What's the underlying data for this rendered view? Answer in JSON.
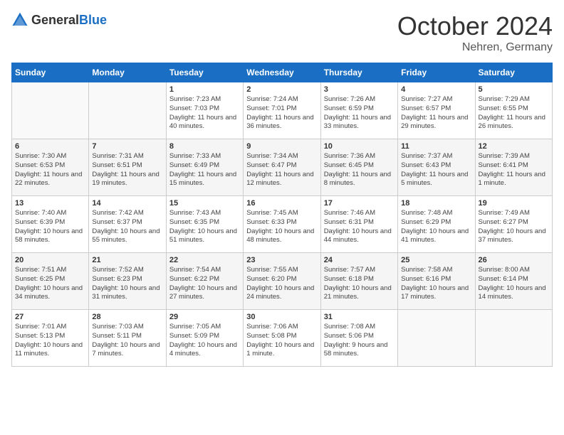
{
  "header": {
    "logo_general": "General",
    "logo_blue": "Blue",
    "month": "October 2024",
    "location": "Nehren, Germany"
  },
  "days_of_week": [
    "Sunday",
    "Monday",
    "Tuesday",
    "Wednesday",
    "Thursday",
    "Friday",
    "Saturday"
  ],
  "weeks": [
    [
      {
        "day": "",
        "info": ""
      },
      {
        "day": "",
        "info": ""
      },
      {
        "day": "1",
        "info": "Sunrise: 7:23 AM\nSunset: 7:03 PM\nDaylight: 11 hours and 40 minutes."
      },
      {
        "day": "2",
        "info": "Sunrise: 7:24 AM\nSunset: 7:01 PM\nDaylight: 11 hours and 36 minutes."
      },
      {
        "day": "3",
        "info": "Sunrise: 7:26 AM\nSunset: 6:59 PM\nDaylight: 11 hours and 33 minutes."
      },
      {
        "day": "4",
        "info": "Sunrise: 7:27 AM\nSunset: 6:57 PM\nDaylight: 11 hours and 29 minutes."
      },
      {
        "day": "5",
        "info": "Sunrise: 7:29 AM\nSunset: 6:55 PM\nDaylight: 11 hours and 26 minutes."
      }
    ],
    [
      {
        "day": "6",
        "info": "Sunrise: 7:30 AM\nSunset: 6:53 PM\nDaylight: 11 hours and 22 minutes."
      },
      {
        "day": "7",
        "info": "Sunrise: 7:31 AM\nSunset: 6:51 PM\nDaylight: 11 hours and 19 minutes."
      },
      {
        "day": "8",
        "info": "Sunrise: 7:33 AM\nSunset: 6:49 PM\nDaylight: 11 hours and 15 minutes."
      },
      {
        "day": "9",
        "info": "Sunrise: 7:34 AM\nSunset: 6:47 PM\nDaylight: 11 hours and 12 minutes."
      },
      {
        "day": "10",
        "info": "Sunrise: 7:36 AM\nSunset: 6:45 PM\nDaylight: 11 hours and 8 minutes."
      },
      {
        "day": "11",
        "info": "Sunrise: 7:37 AM\nSunset: 6:43 PM\nDaylight: 11 hours and 5 minutes."
      },
      {
        "day": "12",
        "info": "Sunrise: 7:39 AM\nSunset: 6:41 PM\nDaylight: 11 hours and 1 minute."
      }
    ],
    [
      {
        "day": "13",
        "info": "Sunrise: 7:40 AM\nSunset: 6:39 PM\nDaylight: 10 hours and 58 minutes."
      },
      {
        "day": "14",
        "info": "Sunrise: 7:42 AM\nSunset: 6:37 PM\nDaylight: 10 hours and 55 minutes."
      },
      {
        "day": "15",
        "info": "Sunrise: 7:43 AM\nSunset: 6:35 PM\nDaylight: 10 hours and 51 minutes."
      },
      {
        "day": "16",
        "info": "Sunrise: 7:45 AM\nSunset: 6:33 PM\nDaylight: 10 hours and 48 minutes."
      },
      {
        "day": "17",
        "info": "Sunrise: 7:46 AM\nSunset: 6:31 PM\nDaylight: 10 hours and 44 minutes."
      },
      {
        "day": "18",
        "info": "Sunrise: 7:48 AM\nSunset: 6:29 PM\nDaylight: 10 hours and 41 minutes."
      },
      {
        "day": "19",
        "info": "Sunrise: 7:49 AM\nSunset: 6:27 PM\nDaylight: 10 hours and 37 minutes."
      }
    ],
    [
      {
        "day": "20",
        "info": "Sunrise: 7:51 AM\nSunset: 6:25 PM\nDaylight: 10 hours and 34 minutes."
      },
      {
        "day": "21",
        "info": "Sunrise: 7:52 AM\nSunset: 6:23 PM\nDaylight: 10 hours and 31 minutes."
      },
      {
        "day": "22",
        "info": "Sunrise: 7:54 AM\nSunset: 6:22 PM\nDaylight: 10 hours and 27 minutes."
      },
      {
        "day": "23",
        "info": "Sunrise: 7:55 AM\nSunset: 6:20 PM\nDaylight: 10 hours and 24 minutes."
      },
      {
        "day": "24",
        "info": "Sunrise: 7:57 AM\nSunset: 6:18 PM\nDaylight: 10 hours and 21 minutes."
      },
      {
        "day": "25",
        "info": "Sunrise: 7:58 AM\nSunset: 6:16 PM\nDaylight: 10 hours and 17 minutes."
      },
      {
        "day": "26",
        "info": "Sunrise: 8:00 AM\nSunset: 6:14 PM\nDaylight: 10 hours and 14 minutes."
      }
    ],
    [
      {
        "day": "27",
        "info": "Sunrise: 7:01 AM\nSunset: 5:13 PM\nDaylight: 10 hours and 11 minutes."
      },
      {
        "day": "28",
        "info": "Sunrise: 7:03 AM\nSunset: 5:11 PM\nDaylight: 10 hours and 7 minutes."
      },
      {
        "day": "29",
        "info": "Sunrise: 7:05 AM\nSunset: 5:09 PM\nDaylight: 10 hours and 4 minutes."
      },
      {
        "day": "30",
        "info": "Sunrise: 7:06 AM\nSunset: 5:08 PM\nDaylight: 10 hours and 1 minute."
      },
      {
        "day": "31",
        "info": "Sunrise: 7:08 AM\nSunset: 5:06 PM\nDaylight: 9 hours and 58 minutes."
      },
      {
        "day": "",
        "info": ""
      },
      {
        "day": "",
        "info": ""
      }
    ]
  ]
}
